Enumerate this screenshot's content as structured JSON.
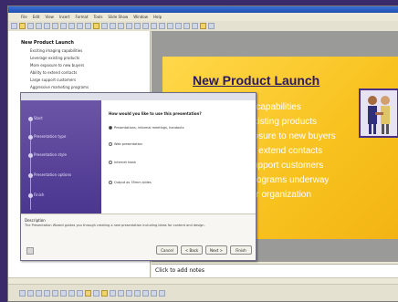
{
  "app": {
    "menu": [
      "File",
      "Edit",
      "View",
      "Insert",
      "Format",
      "Tools",
      "Slide Show",
      "Window",
      "Help"
    ]
  },
  "outline": {
    "title": "New Product Launch",
    "items": [
      "Exciting imaging capabilities",
      "Leverage existing products",
      "More exposure to new buyers",
      "Ability to extend contacts",
      "Large support customers",
      "Aggressive marketing programs"
    ]
  },
  "slide": {
    "title": "New Product Launch",
    "bullets": [
      "g capabilities",
      "existing products",
      "posure to new buyers",
      "to extend contacts",
      "support customers",
      "programs underway",
      "ter organization"
    ]
  },
  "notes": {
    "placeholder": "Click to add notes"
  },
  "dialog": {
    "steps": [
      "Start",
      "Presentation type",
      "Presentation style",
      "Presentation options",
      "Finish"
    ],
    "heading": "How would you like to use this presentation?",
    "options": [
      "Presentations, informal meetings, handouts",
      "Web presentation",
      "Internet kiosk",
      "Output as 35mm slides"
    ],
    "description_label": "Description",
    "description": "The Presentation Wizard guides you through creating a new presentation including ideas for content and design.",
    "buttons": {
      "cancel": "Cancel",
      "back": "< Back",
      "next": "Next >",
      "finish": "Finish"
    }
  }
}
